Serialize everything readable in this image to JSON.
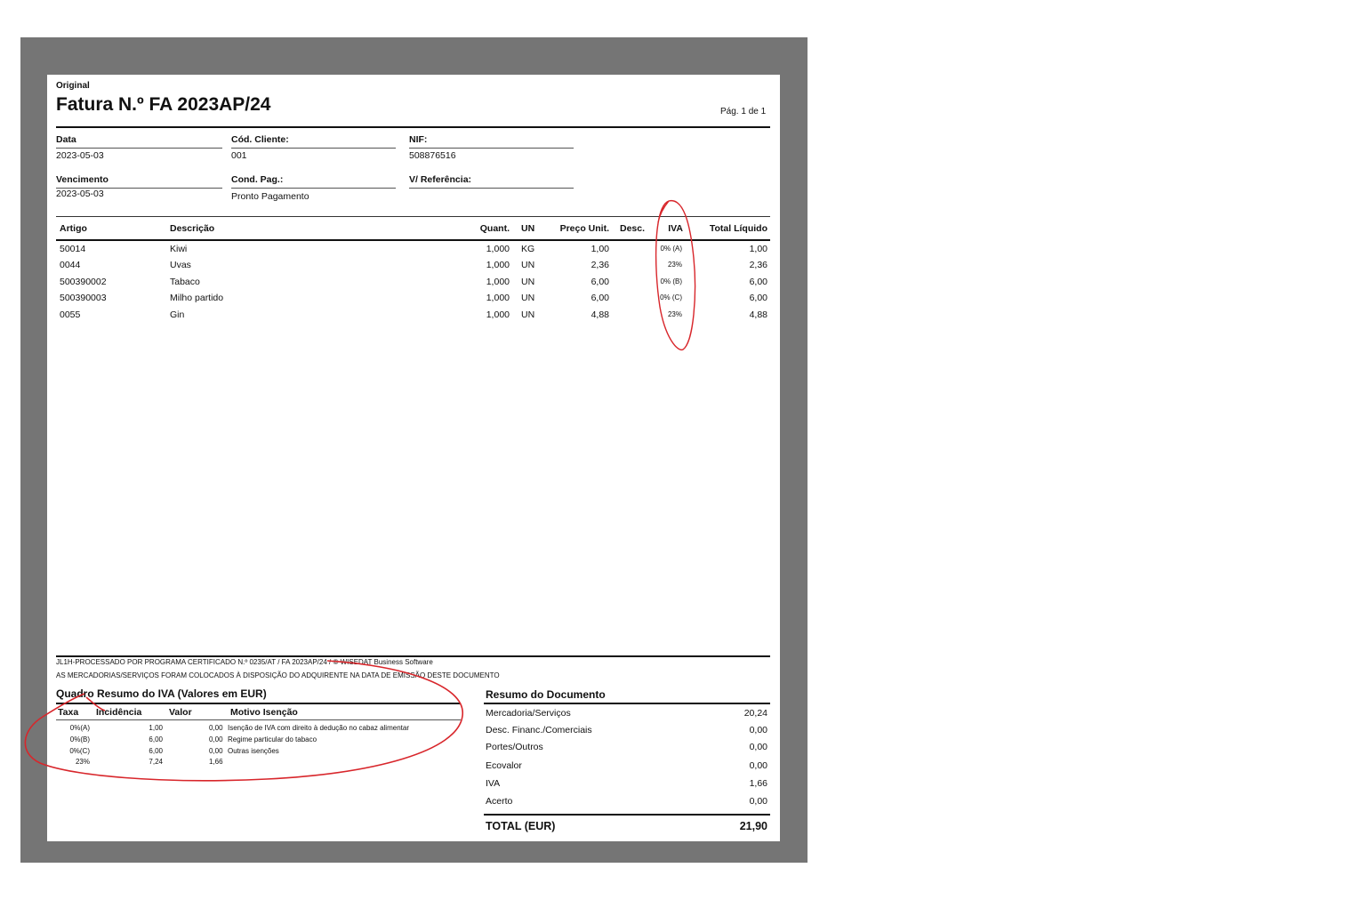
{
  "header": {
    "copy_type": "Original",
    "title": "Fatura N.º FA 2023AP/24",
    "page_info": "Pág. 1 de 1"
  },
  "info": {
    "data_label": "Data",
    "data_value": "2023-05-03",
    "cliente_label": "Cód. Cliente:",
    "cliente_value": "001",
    "nif_label": "NIF:",
    "nif_value": "508876516",
    "vencimento_label": "Vencimento",
    "vencimento_value": "2023-05-03",
    "cond_label": "Cond. Pag.:",
    "cond_value": "Pronto Pagamento",
    "ref_label": "V/ Referência:"
  },
  "lines_header": {
    "artigo": "Artigo",
    "descricao": "Descrição",
    "quant": "Quant.",
    "un": "UN",
    "preco": "Preço Unit.",
    "desc": "Desc.",
    "iva": "IVA",
    "total": "Total Líquido"
  },
  "lines": [
    {
      "artigo": "50014",
      "descricao": "Kiwi",
      "quant": "1,000",
      "un": "KG",
      "preco": "1,00",
      "iva": "0% (A)",
      "total": "1,00"
    },
    {
      "artigo": "0044",
      "descricao": "Uvas",
      "quant": "1,000",
      "un": "UN",
      "preco": "2,36",
      "iva": "23%",
      "total": "2,36"
    },
    {
      "artigo": "500390002",
      "descricao": "Tabaco",
      "quant": "1,000",
      "un": "UN",
      "preco": "6,00",
      "iva": "0% (B)",
      "total": "6,00"
    },
    {
      "artigo": "500390003",
      "descricao": "Milho partido",
      "quant": "1,000",
      "un": "UN",
      "preco": "6,00",
      "iva": "0% (C)",
      "total": "6,00"
    },
    {
      "artigo": "0055",
      "descricao": "Gin",
      "quant": "1,000",
      "un": "UN",
      "preco": "4,88",
      "iva": "23%",
      "total": "4,88"
    }
  ],
  "footer": {
    "processado": "JL1H-PROCESSADO POR PROGRAMA CERTIFICADO N.º 0235/AT / FA 2023AP/24 / © WISEDAT Business Software",
    "mercadorias": "AS MERCADORIAS/SERVIÇOS FORAM COLOCADOS À DISPOSIÇÃO DO ADQUIRENTE NA DATA DE EMISSÃO DESTE DOCUMENTO"
  },
  "iva_summary": {
    "title": "Quadro Resumo do IVA (Valores em EUR)",
    "col_taxa": "Taxa",
    "col_incidencia": "Incidência",
    "col_valor": "Valor",
    "col_motivo": "Motivo Isenção",
    "rows": [
      {
        "taxa": "0%(A)",
        "incidencia": "1,00",
        "valor": "0,00",
        "motivo": "Isenção de IVA com direito à dedução no cabaz alimentar"
      },
      {
        "taxa": "0%(B)",
        "incidencia": "6,00",
        "valor": "0,00",
        "motivo": "Regime particular do tabaco"
      },
      {
        "taxa": "0%(C)",
        "incidencia": "6,00",
        "valor": "0,00",
        "motivo": "Outras isenções"
      },
      {
        "taxa": "23%",
        "incidencia": "7,24",
        "valor": "1,66",
        "motivo": ""
      }
    ]
  },
  "doc_summary": {
    "title": "Resumo do Documento",
    "rows": [
      {
        "label": "Mercadoria/Serviços",
        "value": "20,24"
      },
      {
        "label": "Desc. Financ./Comerciais",
        "value": "0,00"
      },
      {
        "label": "Portes/Outros",
        "value": "0,00"
      },
      {
        "label": "Ecovalor",
        "value": "0,00"
      },
      {
        "label": "IVA",
        "value": "1,66"
      },
      {
        "label": "Acerto",
        "value": "0,00"
      }
    ],
    "total_label": "TOTAL (EUR)",
    "total_value": "21,90"
  },
  "annotation_color": "#d8262b"
}
